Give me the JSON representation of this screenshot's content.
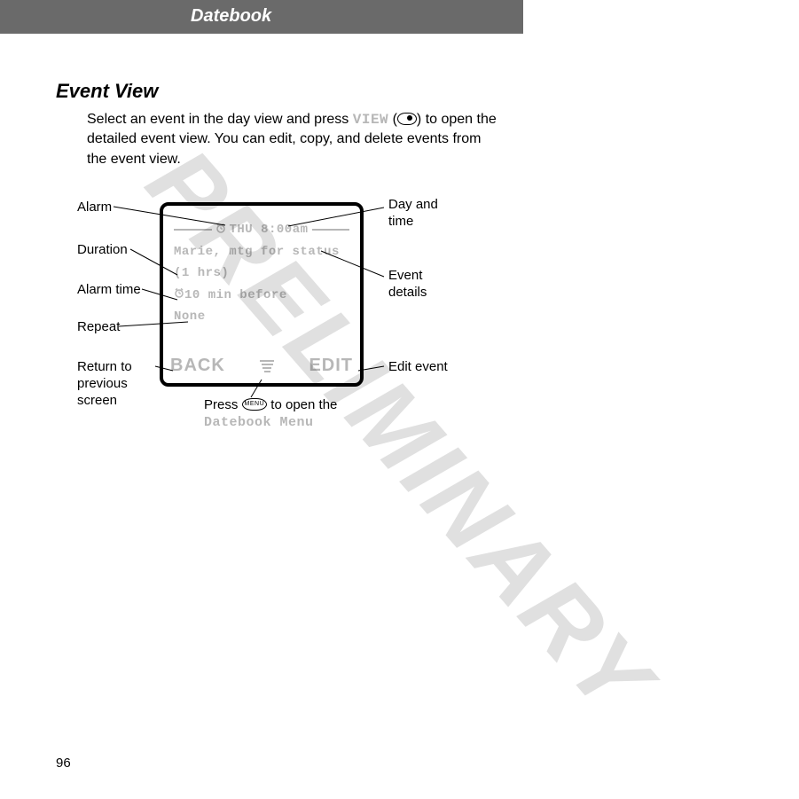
{
  "header": {
    "title": "Datebook"
  },
  "section_title": "Event View",
  "intro": {
    "pre": "Select an event in the day view and press ",
    "view_label": "VIEW",
    "post": ") to open the detailed event view. You can edit, copy, and delete events from the event view."
  },
  "phone": {
    "day_time": "THU 8:00am",
    "details": "Marie, mtg for status",
    "duration": "(1 hrs)",
    "alarm_time": "10 min before",
    "repeat": "None",
    "softkey_left": "BACK",
    "softkey_right": "EDIT"
  },
  "annotations": {
    "alarm": "Alarm",
    "duration": "Duration",
    "alarm_time": "Alarm time",
    "repeat": "Repeat",
    "return": "Return to previous screen",
    "day_time": "Day and time",
    "details": "Event details",
    "edit": "Edit event",
    "menu_pre": "Press ",
    "menu_btn": "MENU",
    "menu_mid": " to open the ",
    "menu_label": "Datebook Menu"
  },
  "watermark": "PRELIMINARY",
  "page_number": "96"
}
